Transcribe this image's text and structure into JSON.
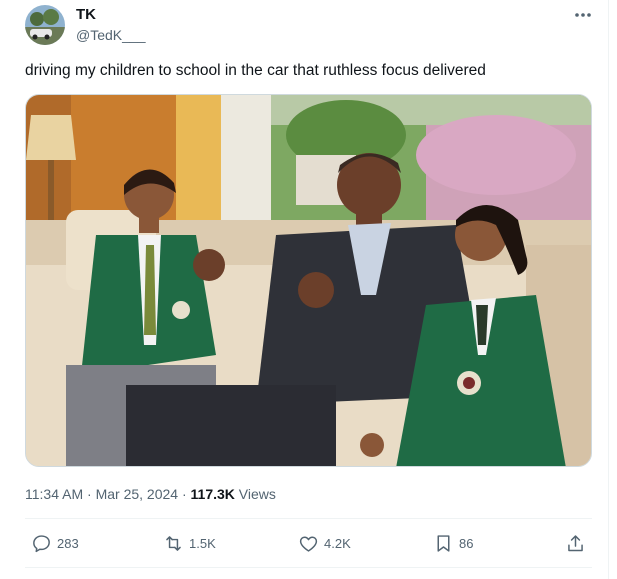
{
  "author": {
    "name": "TK",
    "handle": "@TedK___"
  },
  "tweet": {
    "text": "driving my children to school in the car that ruthless focus delivered"
  },
  "meta": {
    "time": "11:34 AM",
    "separator1": " · ",
    "date": "Mar 25, 2024",
    "separator2": " · ",
    "views_count": "117.3K",
    "views_label": " Views"
  },
  "actions": {
    "replies": "283",
    "reposts": "1.5K",
    "likes": "4.2K",
    "bookmarks": "86"
  },
  "colors": {
    "text_primary": "#0f1419",
    "text_secondary": "#536471",
    "border": "#cfd9de",
    "divider": "#eff3f4",
    "blazer_green": "#1f6b45"
  },
  "icons": [
    "more-icon",
    "reply-icon",
    "repost-icon",
    "like-icon",
    "bookmark-icon",
    "share-icon"
  ]
}
